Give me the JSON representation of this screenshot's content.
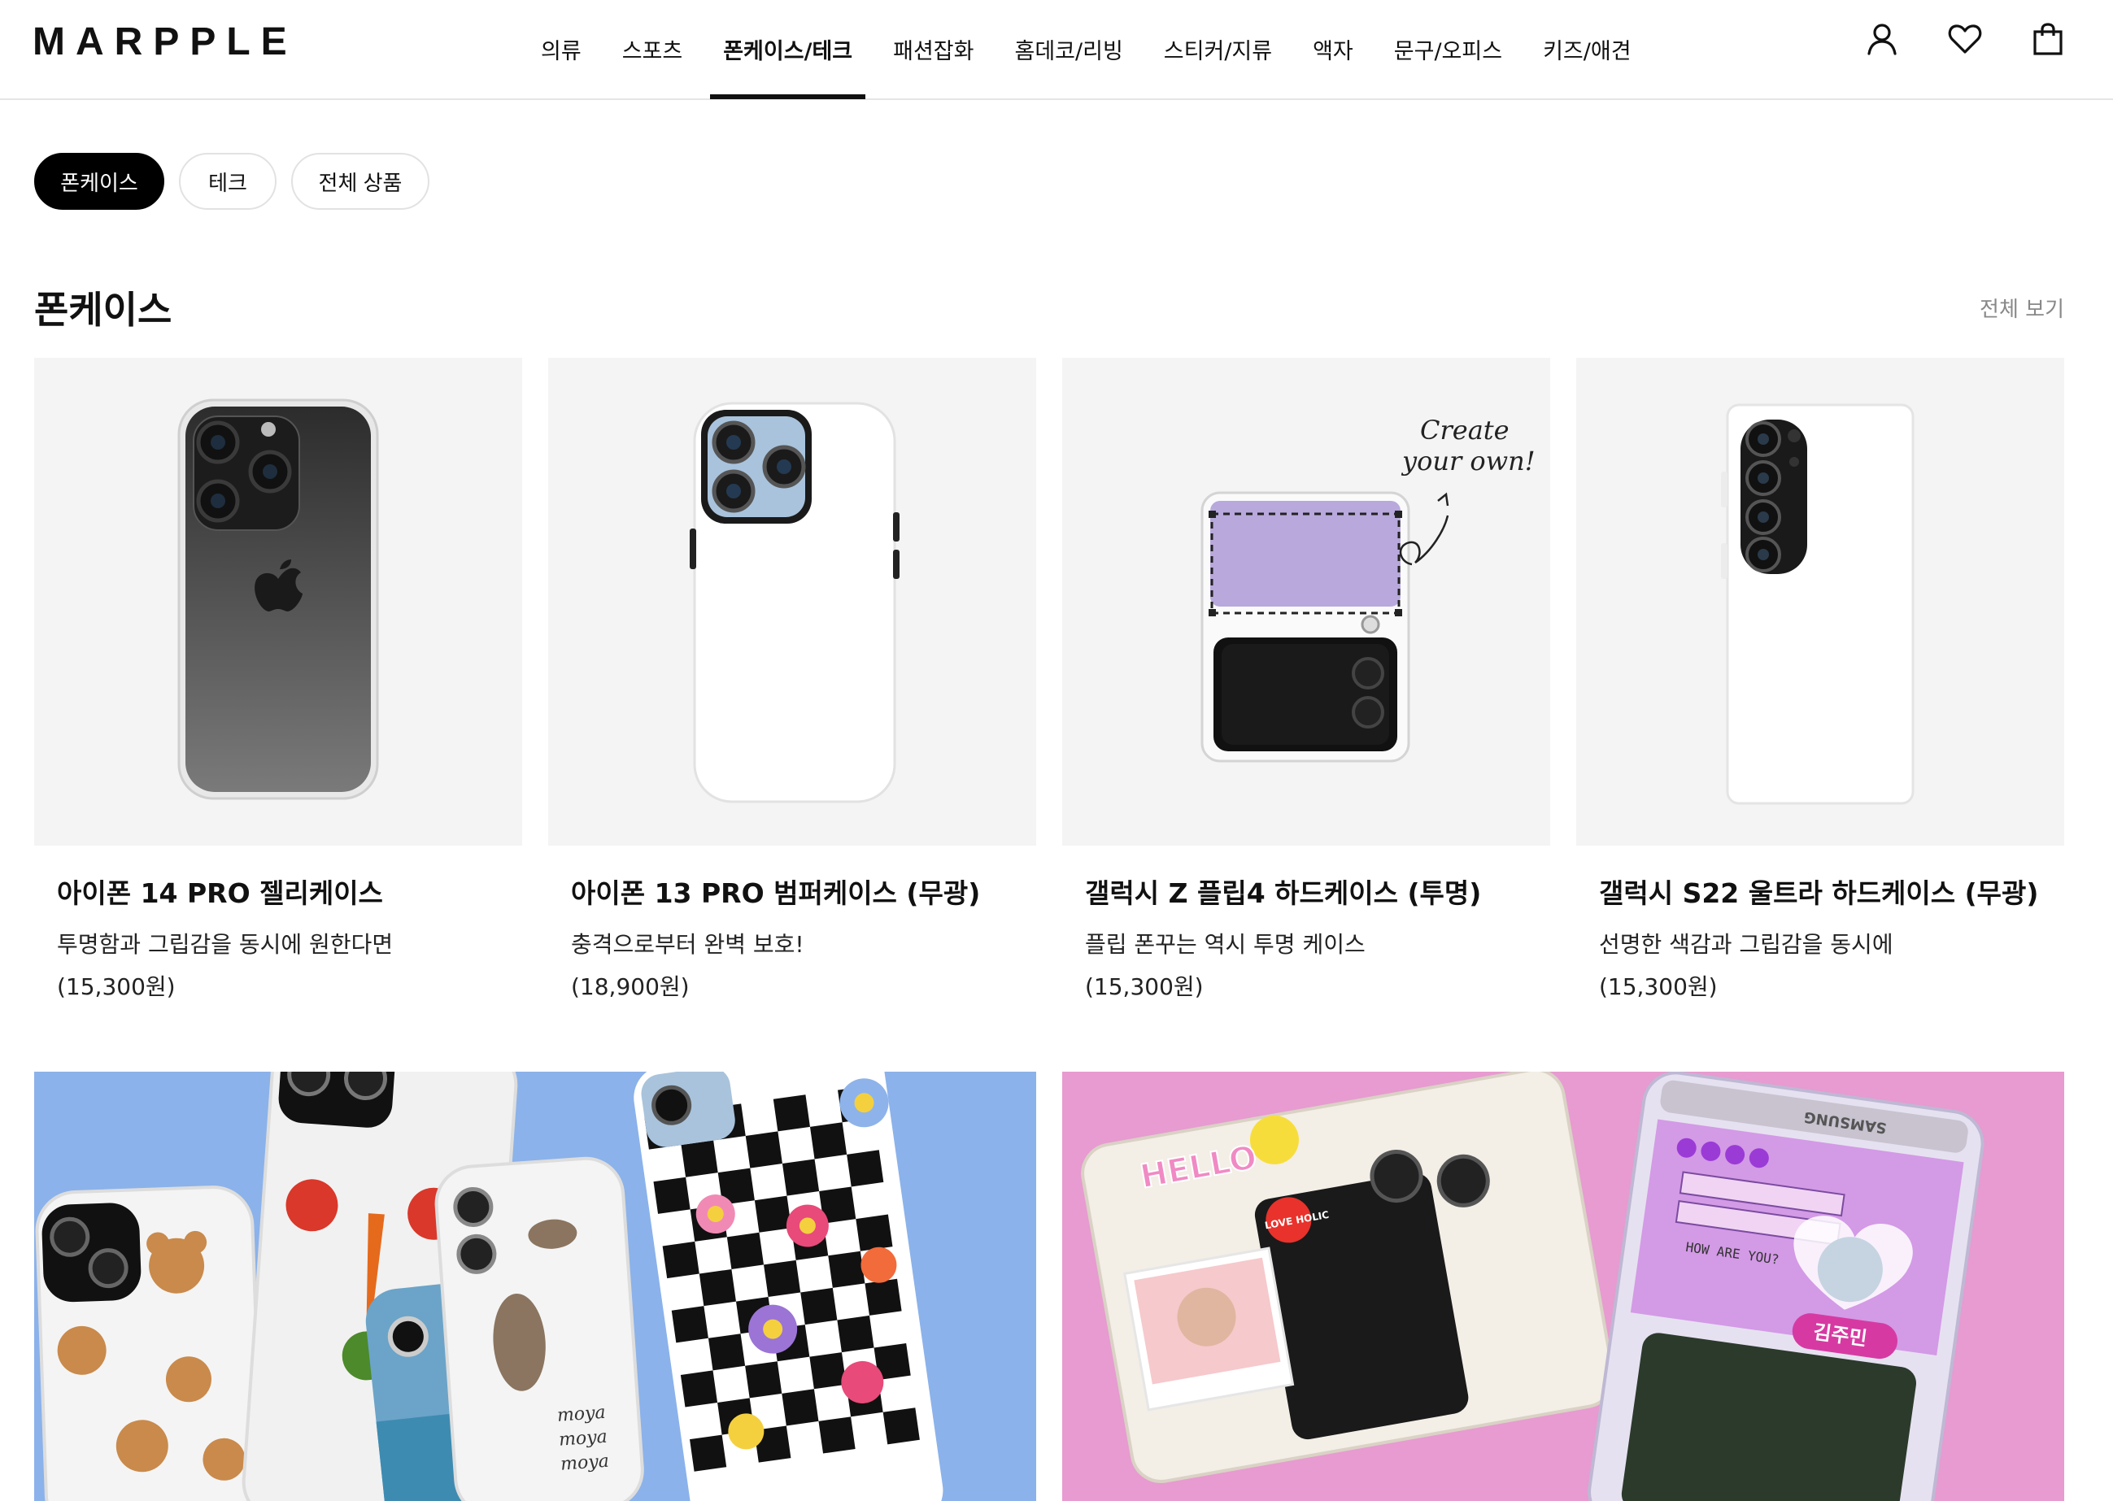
{
  "header": {
    "logo": "MARPPLE",
    "nav": [
      {
        "label": "의류"
      },
      {
        "label": "스포츠"
      },
      {
        "label": "폰케이스/테크",
        "active": true
      },
      {
        "label": "패션잡화"
      },
      {
        "label": "홈데코/리빙"
      },
      {
        "label": "스티커/지류"
      },
      {
        "label": "액자"
      },
      {
        "label": "문구/오피스"
      },
      {
        "label": "키즈/애견"
      }
    ],
    "icons": [
      "user-icon",
      "heart-icon",
      "shopping-bag-icon"
    ]
  },
  "subtabs": [
    {
      "label": "폰케이스",
      "active": true
    },
    {
      "label": "테크"
    },
    {
      "label": "전체 상품"
    }
  ],
  "section": {
    "title": "폰케이스",
    "view_all": "전체 보기"
  },
  "products": [
    {
      "name": "아이폰 14 PRO 젤리케이스",
      "desc": "투명함과 그립감을 동시에 원한다면",
      "price": "(15,300원)"
    },
    {
      "name": "아이폰 13 PRO 범퍼케이스 (무광)",
      "desc": "충격으로부터 완벽 보호!",
      "price": "(18,900원)"
    },
    {
      "name": "갤럭시 Z 플립4 하드케이스 (투명)",
      "desc": "플립 폰꾸는 역시 투명 케이스",
      "price": "(15,300원)"
    },
    {
      "name": "갤럭시 S22 울트라 하드케이스 (무광)",
      "desc": "선명한 색감과 그립감을 동시에",
      "price": "(15,300원)"
    }
  ],
  "thumb_text": {
    "create_line1": "Create",
    "create_line2": "your own!"
  },
  "banners": {
    "left_handwriting": [
      "moya",
      "moya",
      "moya"
    ],
    "right_stickers": [
      "HELLO",
      "LOVE HOLIC",
      "HOW ARE YOU?",
      "김주민",
      "SAMSUNG"
    ]
  },
  "colors": {
    "accent": "#000000",
    "thumb_bg": "#f4f4f4",
    "banner_left_bg": "#8bb2ea",
    "banner_right_bg": "#e79bd0",
    "muted_text": "#888888"
  }
}
